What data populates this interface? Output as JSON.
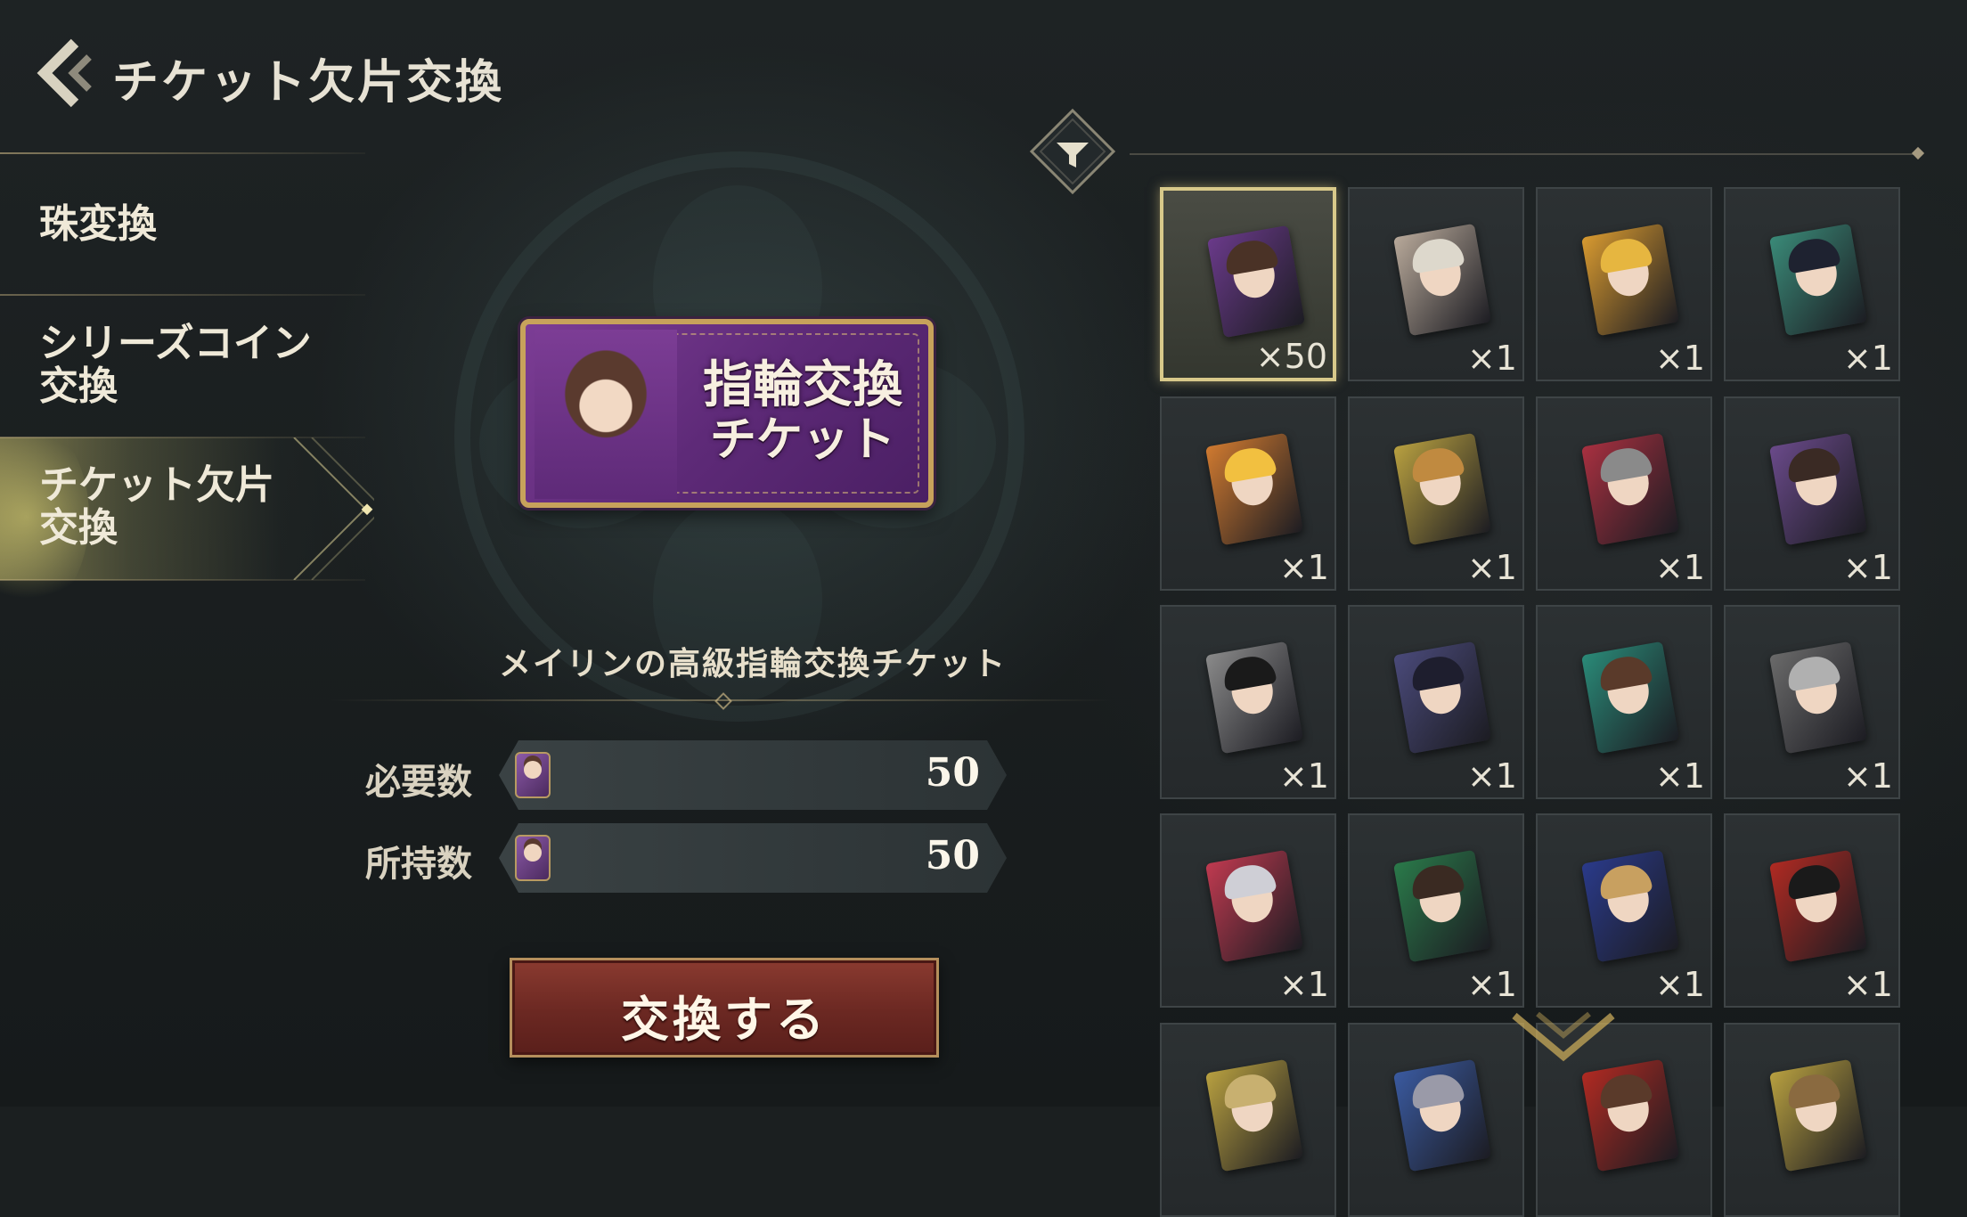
{
  "header": {
    "title": "チケット欠片交換"
  },
  "sidebar": {
    "items": [
      {
        "label": "珠変換"
      },
      {
        "label_line1": "シリーズコイン",
        "label_line2": "交換"
      },
      {
        "label_line1": "チケット欠片",
        "label_line2": "交換",
        "active": true
      }
    ]
  },
  "ticket": {
    "line1": "指輪交換",
    "line2": "チケット",
    "color": "#6a2f86"
  },
  "item": {
    "name": "メイリンの高級指輪交換チケット",
    "required_label": "必要数",
    "required_value": "50",
    "owned_label": "所持数",
    "owned_value": "50"
  },
  "actions": {
    "exchange_label": "交換する"
  },
  "grid": {
    "cells": [
      {
        "qty": "×50",
        "color": "#6a3a8a",
        "hair": "#4a3226",
        "selected": true
      },
      {
        "qty": "×1",
        "color": "#b8a99a",
        "hair": "#ddd8cc"
      },
      {
        "qty": "×1",
        "color": "#d89a30",
        "hair": "#e6b640"
      },
      {
        "qty": "×1",
        "color": "#3a8a78",
        "hair": "#1e2230"
      },
      {
        "qty": "×1",
        "color": "#d07a30",
        "hair": "#f2c040"
      },
      {
        "qty": "×1",
        "color": "#b8a040",
        "hair": "#c08a40"
      },
      {
        "qty": "×1",
        "color": "#a83040",
        "hair": "#8a8a8a"
      },
      {
        "qty": "×1",
        "color": "#6a4a8a",
        "hair": "#3a2a24"
      },
      {
        "qty": "×1",
        "color": "#8a8a8a",
        "hair": "#1a1a1a"
      },
      {
        "qty": "×1",
        "color": "#4a4a7a",
        "hair": "#1e1e2e"
      },
      {
        "qty": "×1",
        "color": "#2a8a78",
        "hair": "#5a3a2a"
      },
      {
        "qty": "×1",
        "color": "#6a6a6a",
        "hair": "#b0b0b0"
      },
      {
        "qty": "×1",
        "color": "#c03a50",
        "hair": "#cfcfd6"
      },
      {
        "qty": "×1",
        "color": "#2a7a4a",
        "hair": "#3a2a22"
      },
      {
        "qty": "×1",
        "color": "#2a3a8a",
        "hair": "#c8a060"
      },
      {
        "qty": "×1",
        "color": "#b02a22",
        "hair": "#1a1a1a"
      },
      {
        "qty": "",
        "color": "#b8a040",
        "hair": "#c8b070"
      },
      {
        "qty": "",
        "color": "#3a5aa0",
        "hair": "#9a9aa8"
      },
      {
        "qty": "",
        "color": "#b02a22",
        "hair": "#5a3a2a"
      },
      {
        "qty": "",
        "color": "#b8a040",
        "hair": "#8a6a40"
      }
    ]
  },
  "icons": {
    "back": "back-chevron-icon",
    "filter": "filter-funnel-icon",
    "scroll": "scroll-down-chevron-icon"
  },
  "colors": {
    "accent_gold": "#d8c98a",
    "button_red": "#6b2822",
    "sidebar_active": "#c8be6e"
  }
}
